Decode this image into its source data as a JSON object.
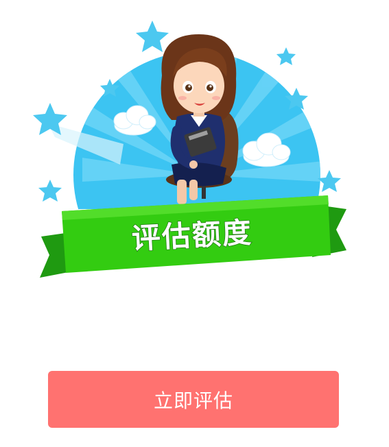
{
  "banner": {
    "title": "评估额度"
  },
  "action": {
    "evaluate_label": "立即评估"
  },
  "colors": {
    "button": "#ff7270",
    "banner": "#33cc11",
    "sky": "#3cc4f2"
  },
  "icons": [
    "star-icon",
    "cloud-icon",
    "woman-avatar-illustration"
  ]
}
